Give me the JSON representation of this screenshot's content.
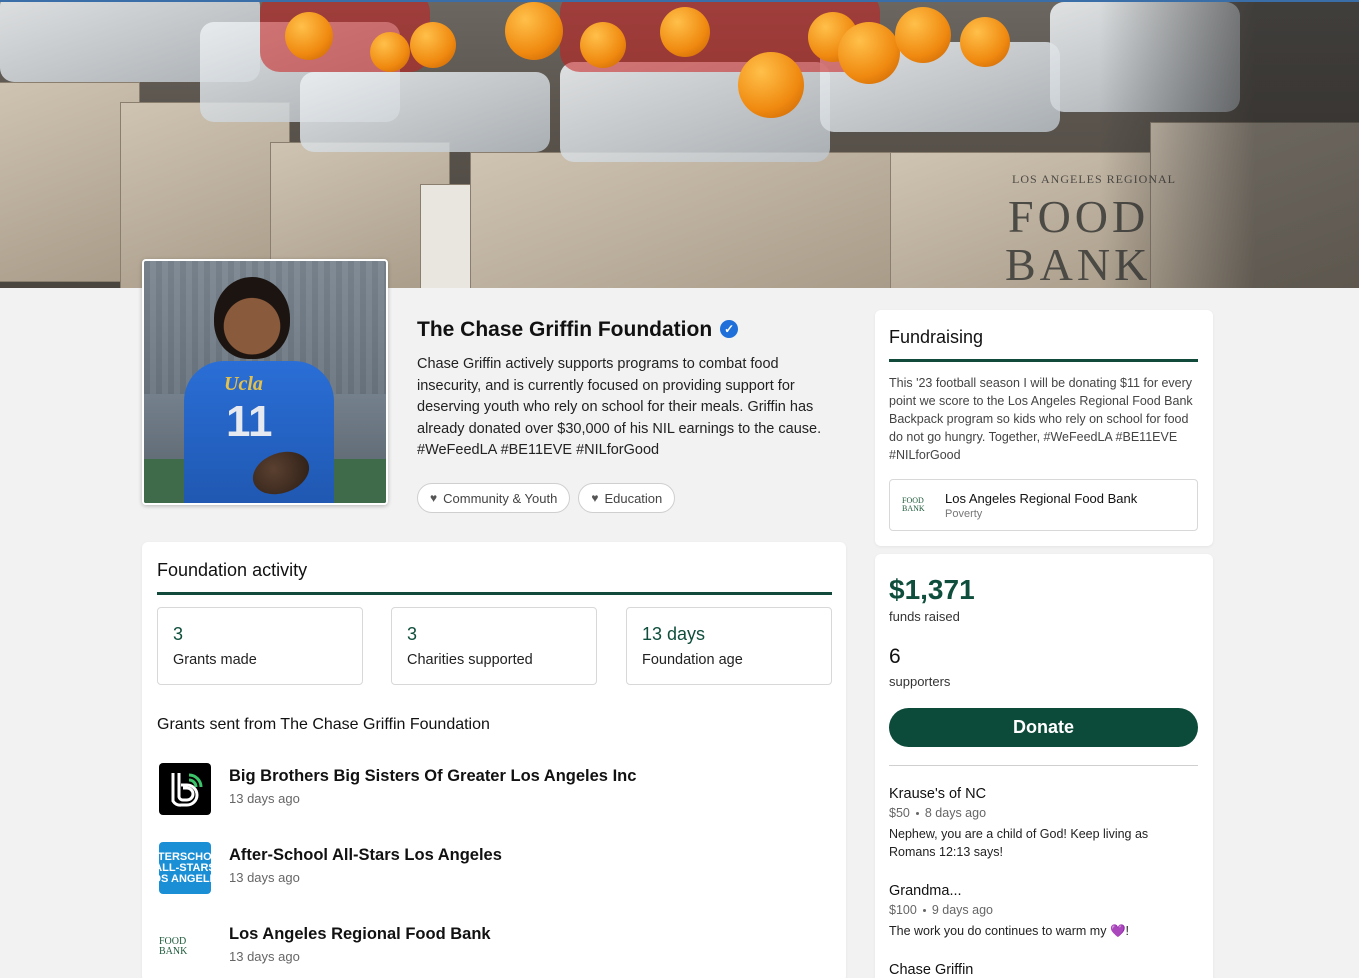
{
  "profile": {
    "name": "The Chase Griffin Foundation",
    "description": "Chase Griffin actively supports programs to combat food insecurity, and is currently focused on providing support for deserving youth who rely on school for their meals. Griffin has already donated over $30,000 of his NIL earnings to the cause. #WeFeedLA #BE11EVE #NILforGood",
    "verified_icon": "verified-check-icon",
    "tags": [
      "Community & Youth",
      "Education"
    ]
  },
  "banner": {
    "box_text_1": "LOS ANGELES REGIONAL",
    "box_text_2": "FOOD",
    "box_text_3": "BANK"
  },
  "photo": {
    "jersey_text": "Ucla",
    "jersey_number": "11"
  },
  "activity": {
    "title": "Foundation activity",
    "stats": [
      {
        "value": "3",
        "label": "Grants made"
      },
      {
        "value": "3",
        "label": "Charities supported"
      },
      {
        "value": "13 days",
        "label": "Foundation age"
      }
    ],
    "grants_title": "Grants sent from The Chase Griffin Foundation",
    "grants": [
      {
        "name": "Big Brothers Big Sisters Of Greater Los Angeles Inc",
        "when": "13 days ago",
        "logo_text": ""
      },
      {
        "name": "After-School All-Stars Los Angeles",
        "when": "13 days ago",
        "logo_text": "AFTERSCHOOL ALL-STARS LOS ANGELES"
      },
      {
        "name": "Los Angeles Regional Food Bank",
        "when": "13 days ago",
        "logo_text": "FOOD BANK"
      }
    ]
  },
  "fundraising": {
    "title": "Fundraising",
    "text": "This '23 football season I will be donating $11 for every point we score to the Los Angeles Regional Food Bank Backpack program so kids who rely on school for food do not go hungry. Together, #WeFeedLA #BE11EVE #NILforGood",
    "charity_name": "Los Angeles Regional Food Bank",
    "charity_category": "Poverty",
    "charity_logo_text": "FOOD BANK"
  },
  "donation": {
    "amount": "$1,371",
    "amount_label": "funds raised",
    "supporters": "6",
    "supporters_label": "supporters",
    "donate_label": "Donate"
  },
  "supporters": [
    {
      "name": "Krause's of NC",
      "amount": "$50",
      "when": "8 days ago",
      "message": "Nephew, you are a child of God! Keep living as Romans 12:13 says!"
    },
    {
      "name": "Grandma...",
      "amount": "$100",
      "when": "9 days ago",
      "message": "The work you do continues to warm my ",
      "emoji": "💜",
      "message_end": "!"
    },
    {
      "name": "Chase Griffin",
      "amount": "",
      "when": "",
      "message": ""
    }
  ],
  "colors": {
    "accent": "#0c4a3a",
    "accent_text": "#0f4e3c",
    "verified": "#1e6fd9"
  }
}
